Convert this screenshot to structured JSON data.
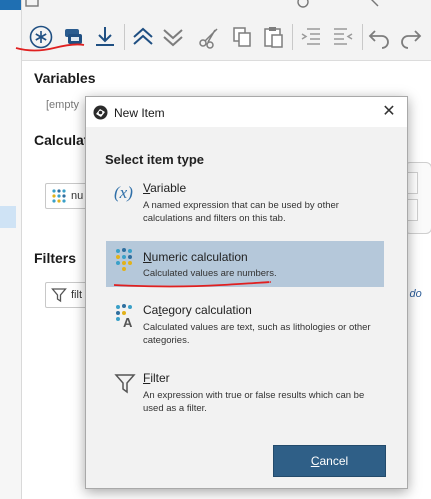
{
  "toolbar": {
    "icons": [
      "new-item-icon",
      "copy-icon",
      "export-icon",
      "move-up-icon",
      "move-down-icon",
      "cut-icon",
      "copy-clipboard-icon",
      "paste-icon",
      "indent-icon",
      "outdent-icon",
      "undo-icon",
      "redo-icon"
    ]
  },
  "panel": {
    "variables_title": "Variables",
    "variables_empty": "[empty",
    "calculations_title": "Calculat",
    "calc_item_label": "nu",
    "filters_title": "Filters",
    "filter_item_label": "filt",
    "filter_side_text": "l do"
  },
  "dialog": {
    "title": "New Item",
    "close_glyph": "✕",
    "heading": "Select item type",
    "options": [
      {
        "name_first": "V",
        "name_rest": "ariable",
        "description": "A named expression that can be used by other calculations and filters on this tab.",
        "icon": "variable-icon",
        "selected": false
      },
      {
        "name_first": "N",
        "name_rest": "umeric calculation",
        "description": "Calculated values are numbers.",
        "icon": "numeric-calculation-icon",
        "selected": true
      },
      {
        "name_first": "Ca",
        "name_mid": "t",
        "name_rest": "egory calculation",
        "description": "Calculated values are text, such as lithologies or other categories.",
        "icon": "category-calculation-icon",
        "selected": false
      },
      {
        "name_first": "F",
        "name_rest": "ilter",
        "description": "An expression with true or false results which can be used as a filter.",
        "icon": "filter-icon",
        "selected": false
      }
    ],
    "cancel_first": "C",
    "cancel_rest": "ancel"
  },
  "colors": {
    "selection": "#b5c8da",
    "primary_button": "#2f5f87",
    "annotation_red": "#e02020"
  }
}
